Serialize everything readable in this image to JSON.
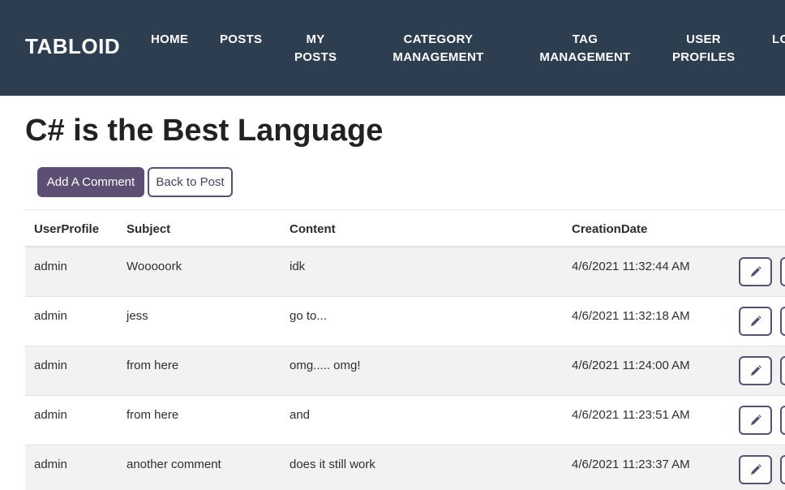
{
  "navbar": {
    "brand": "TABLOID",
    "items": [
      {
        "label": "HOME"
      },
      {
        "label": "POSTS"
      },
      {
        "label": "MY\nPOSTS"
      },
      {
        "label": "CATEGORY\nMANAGEMENT"
      },
      {
        "label": "TAG\nMANAGEMENT"
      },
      {
        "label": "USER\nPROFILES"
      },
      {
        "label": "LO"
      }
    ]
  },
  "page": {
    "title": "C# is the Best Language",
    "add_comment_label": "Add A Comment",
    "back_label": "Back to Post"
  },
  "table": {
    "headers": [
      "UserProfile",
      "Subject",
      "Content",
      "CreationDate"
    ],
    "rows": [
      {
        "user": "admin",
        "subject": "Wooooork",
        "content": "idk",
        "date": "4/6/2021 11:32:44 AM"
      },
      {
        "user": "admin",
        "subject": "jess",
        "content": "go to...",
        "date": "4/6/2021 11:32:18 AM"
      },
      {
        "user": "admin",
        "subject": "from here",
        "content": "omg..... omg!",
        "date": "4/6/2021 11:24:00 AM"
      },
      {
        "user": "admin",
        "subject": "from here",
        "content": "and",
        "date": "4/6/2021 11:23:51 AM"
      },
      {
        "user": "admin",
        "subject": "another comment",
        "content": "does it still work",
        "date": "4/6/2021 11:23:37 AM"
      }
    ]
  },
  "icons": {
    "edit": "pencil-icon",
    "delete": "trash-icon"
  },
  "colors": {
    "navbar": "#2c3e50",
    "accent": "#5c4f73",
    "stripe": "#f2f2f2"
  }
}
